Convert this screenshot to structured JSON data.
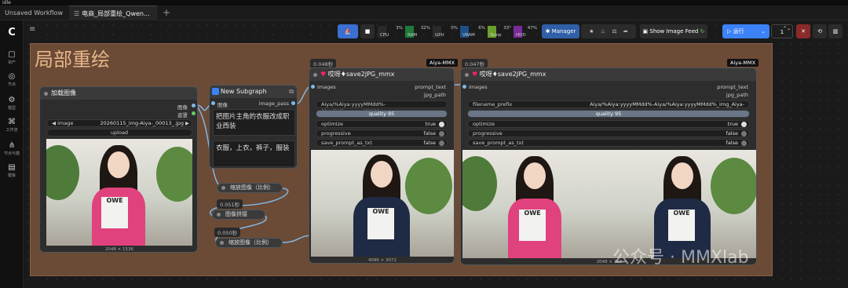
{
  "window": {
    "title": "idle"
  },
  "tabs": [
    {
      "label": "Unsaved Workflow"
    },
    {
      "label": "电商_局部重绘_Qwen..."
    }
  ],
  "sidebar": {
    "items": [
      {
        "label": "资产",
        "icon": "cube-icon"
      },
      {
        "label": "节点",
        "icon": "node-icon"
      },
      {
        "label": "模型",
        "icon": "model-icon"
      },
      {
        "label": "工作流",
        "icon": "workflow-icon"
      },
      {
        "label": "节点与模",
        "icon": "node-library-icon"
      },
      {
        "label": "模板",
        "icon": "template-icon"
      }
    ]
  },
  "toolbar": {
    "stats": [
      {
        "label": "CPU",
        "value": "3%",
        "color": "#2a2a2a"
      },
      {
        "label": "RAM",
        "value": "32%",
        "color": "#1f7a3a"
      },
      {
        "label": "GPU",
        "value": "0%",
        "color": "#2a2a2a"
      },
      {
        "label": "VRAM",
        "value": "6%",
        "color": "#1e4f8a"
      },
      {
        "label": "Temp",
        "value": "33°",
        "color": "#6aa02a"
      },
      {
        "label": "HDD",
        "value": "47%",
        "color": "#7a2a9a"
      }
    ],
    "manager_label": "Manager",
    "show_image_feed_label": "Show Image Feed",
    "run_label": "运行",
    "run_count": "1",
    "accent_color": "#3b82f6"
  },
  "group": {
    "title": "局部重绘"
  },
  "load_image_node": {
    "title": "加载图像",
    "outputs": [
      "图像",
      "遮罩"
    ],
    "image_widget_label": "image",
    "image_widget_value": "20260115_img-Aiya-_00013_.jpg",
    "upload_label": "upload",
    "dimensions": "2048 × 1536"
  },
  "subgraph_node": {
    "title": "New Subgraph",
    "input_label": "图像",
    "output_label": "image_pass",
    "prompt_text": "把图片主角的衣服改成职业西装",
    "tags_text": "衣服，上衣，裤子，服装"
  },
  "mini_nodes": {
    "scale1": "缩放图像（比例）",
    "time1": "0.051秒",
    "stitch": "图像拼接",
    "time2": "0.050秒",
    "scale2": "缩放图像（比例）"
  },
  "save_node_1": {
    "time": "0.048秒",
    "badge": "Aiya-MMX",
    "title": "哎呀♦save2JPG_mmx",
    "input": "images",
    "outputs": [
      "prompt_text",
      "jpg_path"
    ],
    "filename_prefix": "Aiya/%Aiya:yyyyMMdd%-Aiya/%Aiya:yyyyMMdd ...",
    "quality_label": "quality",
    "quality_value": "95",
    "optimize_label": "optimize",
    "optimize_value": "true",
    "progressive_label": "progressive",
    "progressive_value": "false",
    "save_prompt_label": "save_prompt_as_txt",
    "save_prompt_value": "false",
    "dimensions": "4096 × 3072"
  },
  "save_node_2": {
    "time": "0.047秒",
    "badge": "Aiya-MMX",
    "title": "哎呀♦save2JPG_mmx",
    "input": "images",
    "outputs": [
      "prompt_text",
      "jpg_path"
    ],
    "filename_prefix_label": "filename_prefix",
    "filename_prefix_value": "Aiya/%Aiya:yyyyMMdd%-Aiya/%Aiya:yyyyMMdd%_img_Aiya-",
    "quality_label": "quality",
    "quality_value": "95",
    "optimize_label": "optimize",
    "optimize_value": "true",
    "progressive_label": "progressive",
    "progressive_value": "false",
    "save_prompt_label": "save_prompt_as_txt",
    "save_prompt_value": "false",
    "dimensions": "2048 × 768"
  },
  "watermark": "公众号 · MMXlab",
  "photo_text": "OWE"
}
